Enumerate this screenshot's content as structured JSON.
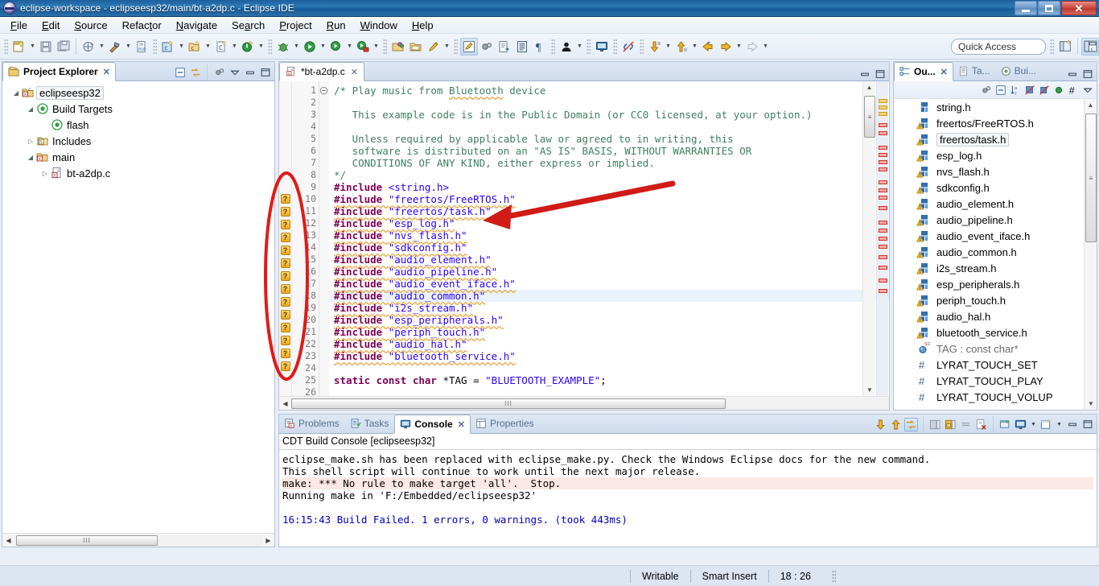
{
  "window": {
    "title": "eclipse-workspace - eclipseesp32/main/bt-a2dp.c - Eclipse IDE",
    "icon": "eclipse-logo-icon",
    "minimize_label": "Minimize",
    "maximize_label": "Restore",
    "close_label": "Close"
  },
  "menubar": {
    "items": [
      {
        "label": "File",
        "mnemonic": "F"
      },
      {
        "label": "Edit",
        "mnemonic": "E"
      },
      {
        "label": "Source",
        "mnemonic": "S"
      },
      {
        "label": "Refactor",
        "mnemonic": "t"
      },
      {
        "label": "Navigate",
        "mnemonic": "N"
      },
      {
        "label": "Search",
        "mnemonic": "a"
      },
      {
        "label": "Project",
        "mnemonic": "P"
      },
      {
        "label": "Run",
        "mnemonic": "R"
      },
      {
        "label": "Window",
        "mnemonic": "W"
      },
      {
        "label": "Help",
        "mnemonic": "H"
      }
    ]
  },
  "toolbar": {
    "quick_access_placeholder": "Quick Access",
    "buttons": [
      "new-wizard-icon",
      "save-icon",
      "save-all-icon",
      "print-icon",
      "build-hammer-icon",
      "new-c-file-icon",
      "new-c-project-icon",
      "new-c-class-icon",
      "run-last-tool-icon",
      "debug-icon",
      "run-icon",
      "coverage-icon",
      "profile-icon",
      "open-type-icon",
      "open-element-icon",
      "pencil-icon",
      "toggle-mark-occurrences-icon",
      "skip-breakpoints-icon",
      "external-tools-icon",
      "show-whitespace-icon",
      "pilcrow-icon",
      "person-icon",
      "console-icon",
      "unlink-icon",
      "next-annotation-icon",
      "previous-annotation-icon",
      "back-icon",
      "forward-icon"
    ],
    "perspective_buttons": [
      "open-perspective-icon",
      "c-cpp-perspective-icon"
    ]
  },
  "project_explorer": {
    "tab_label": "Project Explorer",
    "tab_icon": "project-explorer-icon",
    "toolbar_icons": [
      "collapse-all-icon",
      "link-with-editor-icon",
      "view-menu-filter-icon",
      "view-menu-icon",
      "minimize-icon",
      "maximize-icon"
    ],
    "tree": [
      {
        "label": "eclipseesp32",
        "depth": 0,
        "twisty": "expanded",
        "icon": "c-project-icon",
        "selected": true
      },
      {
        "label": "Build Targets",
        "depth": 1,
        "twisty": "expanded",
        "icon": "build-target-icon",
        "selected": false
      },
      {
        "label": "flash",
        "depth": 2,
        "twisty": "none",
        "icon": "build-target-icon",
        "selected": false
      },
      {
        "label": "Includes",
        "depth": 1,
        "twisty": "collapsed",
        "icon": "includes-folder-icon",
        "selected": false
      },
      {
        "label": "main",
        "depth": 1,
        "twisty": "expanded",
        "icon": "source-folder-icon",
        "selected": false
      },
      {
        "label": "bt-a2dp.c",
        "depth": 2,
        "twisty": "collapsed",
        "icon": "c-file-icon",
        "selected": false
      }
    ],
    "hscroll_thumb_label": "III"
  },
  "editor": {
    "tab_label": "*bt-a2dp.c",
    "tab_icon": "c-file-icon",
    "tab_close_label": "x",
    "minimize_label": "Minimize",
    "maximize_label": "Maximize",
    "lines": [
      {
        "n": 1,
        "fold": "collapse",
        "marker": "",
        "current": false,
        "segments": [
          {
            "text": "/* Play music from ",
            "cls": "c-comment"
          },
          {
            "text": "Bluetooth",
            "cls": "c-comment squiggle"
          },
          {
            "text": " device",
            "cls": "c-comment"
          }
        ]
      },
      {
        "n": 2,
        "fold": "",
        "marker": "",
        "current": false,
        "segments": [
          {
            "text": "",
            "cls": "c-comment"
          }
        ]
      },
      {
        "n": 3,
        "fold": "",
        "marker": "",
        "current": false,
        "segments": [
          {
            "text": "   This example code is in the Public Domain (or CC0 licensed, at your option.)",
            "cls": "c-comment"
          }
        ]
      },
      {
        "n": 4,
        "fold": "",
        "marker": "",
        "current": false,
        "segments": [
          {
            "text": "",
            "cls": "c-comment"
          }
        ]
      },
      {
        "n": 5,
        "fold": "",
        "marker": "",
        "current": false,
        "segments": [
          {
            "text": "   Unless required by applicable law or agreed to in writing, this",
            "cls": "c-comment"
          }
        ]
      },
      {
        "n": 6,
        "fold": "",
        "marker": "",
        "current": false,
        "segments": [
          {
            "text": "   software is distributed on an \"AS IS\" BASIS, WITHOUT WARRANTIES OR",
            "cls": "c-comment"
          }
        ]
      },
      {
        "n": 7,
        "fold": "",
        "marker": "",
        "current": false,
        "segments": [
          {
            "text": "   CONDITIONS OF ANY KIND, either express or implied.",
            "cls": "c-comment"
          }
        ]
      },
      {
        "n": 8,
        "fold": "",
        "marker": "",
        "current": false,
        "segments": [
          {
            "text": "*/",
            "cls": "c-comment"
          }
        ]
      },
      {
        "n": 9,
        "fold": "",
        "marker": "",
        "current": false,
        "segments": [
          {
            "text": "#include ",
            "cls": "c-pp"
          },
          {
            "text": "<string.h>",
            "cls": "c-str"
          }
        ]
      },
      {
        "n": 10,
        "fold": "",
        "marker": "warning",
        "current": false,
        "segments": [
          {
            "text": "#include ",
            "cls": "c-pp squiggle"
          },
          {
            "text": "\"freertos/FreeRTOS.h\"",
            "cls": "c-str squiggle"
          }
        ]
      },
      {
        "n": 11,
        "fold": "",
        "marker": "warning",
        "current": false,
        "segments": [
          {
            "text": "#include ",
            "cls": "c-pp squiggle"
          },
          {
            "text": "\"freertos/task.h\"",
            "cls": "c-str squiggle"
          }
        ]
      },
      {
        "n": 12,
        "fold": "",
        "marker": "warning",
        "current": false,
        "segments": [
          {
            "text": "#include ",
            "cls": "c-pp squiggle"
          },
          {
            "text": "\"esp_log.h\"",
            "cls": "c-str squiggle"
          }
        ]
      },
      {
        "n": 13,
        "fold": "",
        "marker": "warning",
        "current": false,
        "segments": [
          {
            "text": "#include ",
            "cls": "c-pp squiggle"
          },
          {
            "text": "\"nvs_flash.h\"",
            "cls": "c-str squiggle"
          }
        ]
      },
      {
        "n": 14,
        "fold": "",
        "marker": "warning",
        "current": false,
        "segments": [
          {
            "text": "#include ",
            "cls": "c-pp squiggle"
          },
          {
            "text": "\"sdkconfig.h\"",
            "cls": "c-str squiggle"
          }
        ]
      },
      {
        "n": 15,
        "fold": "",
        "marker": "warning",
        "current": false,
        "segments": [
          {
            "text": "#include ",
            "cls": "c-pp squiggle"
          },
          {
            "text": "\"audio_element.h\"",
            "cls": "c-str squiggle"
          }
        ]
      },
      {
        "n": 16,
        "fold": "",
        "marker": "warning",
        "current": false,
        "segments": [
          {
            "text": "#include ",
            "cls": "c-pp squiggle"
          },
          {
            "text": "\"audio_pipeline.h\"",
            "cls": "c-str squiggle"
          }
        ]
      },
      {
        "n": 17,
        "fold": "",
        "marker": "warning",
        "current": false,
        "segments": [
          {
            "text": "#include ",
            "cls": "c-pp squiggle"
          },
          {
            "text": "\"audio_event_iface.h\"",
            "cls": "c-str squiggle"
          }
        ]
      },
      {
        "n": 18,
        "fold": "",
        "marker": "warning",
        "current": true,
        "segments": [
          {
            "text": "#include ",
            "cls": "c-pp squiggle"
          },
          {
            "text": "\"audio_common.h\"",
            "cls": "c-str squiggle"
          }
        ]
      },
      {
        "n": 19,
        "fold": "",
        "marker": "warning",
        "current": false,
        "segments": [
          {
            "text": "#include ",
            "cls": "c-pp squiggle"
          },
          {
            "text": "\"i2s_stream.h\"",
            "cls": "c-str squiggle"
          }
        ]
      },
      {
        "n": 20,
        "fold": "",
        "marker": "warning",
        "current": false,
        "segments": [
          {
            "text": "#include ",
            "cls": "c-pp squiggle"
          },
          {
            "text": "\"esp_peripherals.h\"",
            "cls": "c-str squiggle"
          }
        ]
      },
      {
        "n": 21,
        "fold": "",
        "marker": "warning",
        "current": false,
        "segments": [
          {
            "text": "#include ",
            "cls": "c-pp squiggle"
          },
          {
            "text": "\"periph_touch.h\"",
            "cls": "c-str squiggle"
          }
        ]
      },
      {
        "n": 22,
        "fold": "",
        "marker": "warning",
        "current": false,
        "segments": [
          {
            "text": "#include ",
            "cls": "c-pp squiggle"
          },
          {
            "text": "\"audio_hal.h\"",
            "cls": "c-str squiggle"
          }
        ]
      },
      {
        "n": 23,
        "fold": "",
        "marker": "warning",
        "current": false,
        "segments": [
          {
            "text": "#include ",
            "cls": "c-pp squiggle"
          },
          {
            "text": "\"bluetooth_service.h\"",
            "cls": "c-str squiggle"
          }
        ]
      },
      {
        "n": 24,
        "fold": "",
        "marker": "",
        "current": false,
        "segments": [
          {
            "text": "",
            "cls": "c-plain"
          }
        ]
      },
      {
        "n": 25,
        "fold": "",
        "marker": "",
        "current": false,
        "segments": [
          {
            "text": "static const char ",
            "cls": "c-kw"
          },
          {
            "text": "*TAG = ",
            "cls": "c-plain"
          },
          {
            "text": "\"BLUETOOTH_EXAMPLE\"",
            "cls": "c-str"
          },
          {
            "text": ";",
            "cls": "c-plain"
          }
        ]
      },
      {
        "n": 26,
        "fold": "",
        "marker": "",
        "current": false,
        "segments": [
          {
            "text": "",
            "cls": "c-plain"
          }
        ]
      }
    ],
    "hscroll_thumb_label": "III",
    "vscroll_thumb_label": "≡"
  },
  "outline": {
    "tabs": [
      {
        "label": "Ou...",
        "icon": "outline-icon",
        "active": true,
        "close": "x"
      },
      {
        "label": "Ta...",
        "icon": "task-list-icon",
        "active": false
      },
      {
        "label": "Bui...",
        "icon": "build-targets-icon",
        "active": false
      }
    ],
    "toolbar_icons": [
      "focus-active-task-icon",
      "collapse-all-icon",
      "sort-az-icon",
      "hide-fields-icon",
      "hide-static-icon",
      "hide-non-public-icon",
      "hide-macros-icon",
      "view-menu-icon"
    ],
    "items": [
      {
        "label": "string.h",
        "icon": "include-icon",
        "warning": false,
        "selected": false
      },
      {
        "label": "freertos/FreeRTOS.h",
        "icon": "include-icon",
        "warning": true,
        "selected": false
      },
      {
        "label": "freertos/task.h",
        "icon": "include-icon",
        "warning": true,
        "selected": true
      },
      {
        "label": "esp_log.h",
        "icon": "include-icon",
        "warning": true,
        "selected": false
      },
      {
        "label": "nvs_flash.h",
        "icon": "include-icon",
        "warning": true,
        "selected": false
      },
      {
        "label": "sdkconfig.h",
        "icon": "include-icon",
        "warning": true,
        "selected": false
      },
      {
        "label": "audio_element.h",
        "icon": "include-icon",
        "warning": true,
        "selected": false
      },
      {
        "label": "audio_pipeline.h",
        "icon": "include-icon",
        "warning": true,
        "selected": false
      },
      {
        "label": "audio_event_iface.h",
        "icon": "include-icon",
        "warning": true,
        "selected": false
      },
      {
        "label": "audio_common.h",
        "icon": "include-icon",
        "warning": true,
        "selected": false
      },
      {
        "label": "i2s_stream.h",
        "icon": "include-icon",
        "warning": true,
        "selected": false
      },
      {
        "label": "esp_peripherals.h",
        "icon": "include-icon",
        "warning": true,
        "selected": false
      },
      {
        "label": "periph_touch.h",
        "icon": "include-icon",
        "warning": true,
        "selected": false
      },
      {
        "label": "audio_hal.h",
        "icon": "include-icon",
        "warning": true,
        "selected": false
      },
      {
        "label": "bluetooth_service.h",
        "icon": "include-icon",
        "warning": true,
        "selected": false
      },
      {
        "label": "TAG : const char*",
        "icon": "variable-static-const-icon",
        "warning": false,
        "selected": false
      },
      {
        "label": "LYRAT_TOUCH_SET",
        "icon": "macro-icon",
        "warning": false,
        "selected": false
      },
      {
        "label": "LYRAT_TOUCH_PLAY",
        "icon": "macro-icon",
        "warning": false,
        "selected": false
      },
      {
        "label": "LYRAT_TOUCH_VOLUP",
        "icon": "macro-icon",
        "warning": false,
        "selected": false
      }
    ]
  },
  "console": {
    "tabs": [
      {
        "label": "Problems",
        "icon": "problems-icon",
        "active": false
      },
      {
        "label": "Tasks",
        "icon": "tasks-icon",
        "active": false
      },
      {
        "label": "Console",
        "icon": "console-icon",
        "active": true,
        "close": "x"
      },
      {
        "label": "Properties",
        "icon": "properties-icon",
        "active": false
      }
    ],
    "toolbar_icons": [
      "scroll-lock-down-icon",
      "scroll-lock-up-icon",
      "toggle-word-wrap-icon",
      "save-console-icon",
      "lock-console-icon",
      "clear-console-icon",
      "remove-console-icon",
      "open-console-icon",
      "display-selected-console-icon",
      "new-console-view-icon",
      "minimize-icon",
      "maximize-icon"
    ],
    "header": "CDT Build Console [eclipseesp32]",
    "lines": [
      {
        "text": "eclipse_make.sh has been replaced with eclipse_make.py. Check the Windows Eclipse docs for the new command.",
        "style": "normal"
      },
      {
        "text": "This shell script will continue to work until the next major release.",
        "style": "normal"
      },
      {
        "text": "make: *** No rule to make target 'all'.  Stop.",
        "style": "error"
      },
      {
        "text": "Running make in 'F:/Embedded/eclipseesp32'",
        "style": "normal"
      },
      {
        "text": "",
        "style": "normal"
      },
      {
        "text": "16:15:43 Build Failed. 1 errors, 0 warnings. (took 443ms)",
        "style": "blue"
      }
    ]
  },
  "statusbar": {
    "writable": "Writable",
    "insert_mode": "Smart Insert",
    "cursor_position": "18 : 26"
  },
  "annotations": {
    "ellipse": {
      "color": "#e01b18",
      "label": "warning-markers-highlight-ellipse"
    },
    "arrow": {
      "color": "#d11b16",
      "label": "include-lines-pointer-arrow"
    }
  },
  "colors": {
    "titlebar_blue": "#1d5f9e",
    "annotation_red": "#e01b18",
    "warning_yellow": "#e9a720",
    "error_red": "#d0342c",
    "selection_blue": "#eaf2fb",
    "comment_green": "#3f7f5f",
    "string_blue": "#2a00ff",
    "keyword_purple": "#7f0055"
  }
}
